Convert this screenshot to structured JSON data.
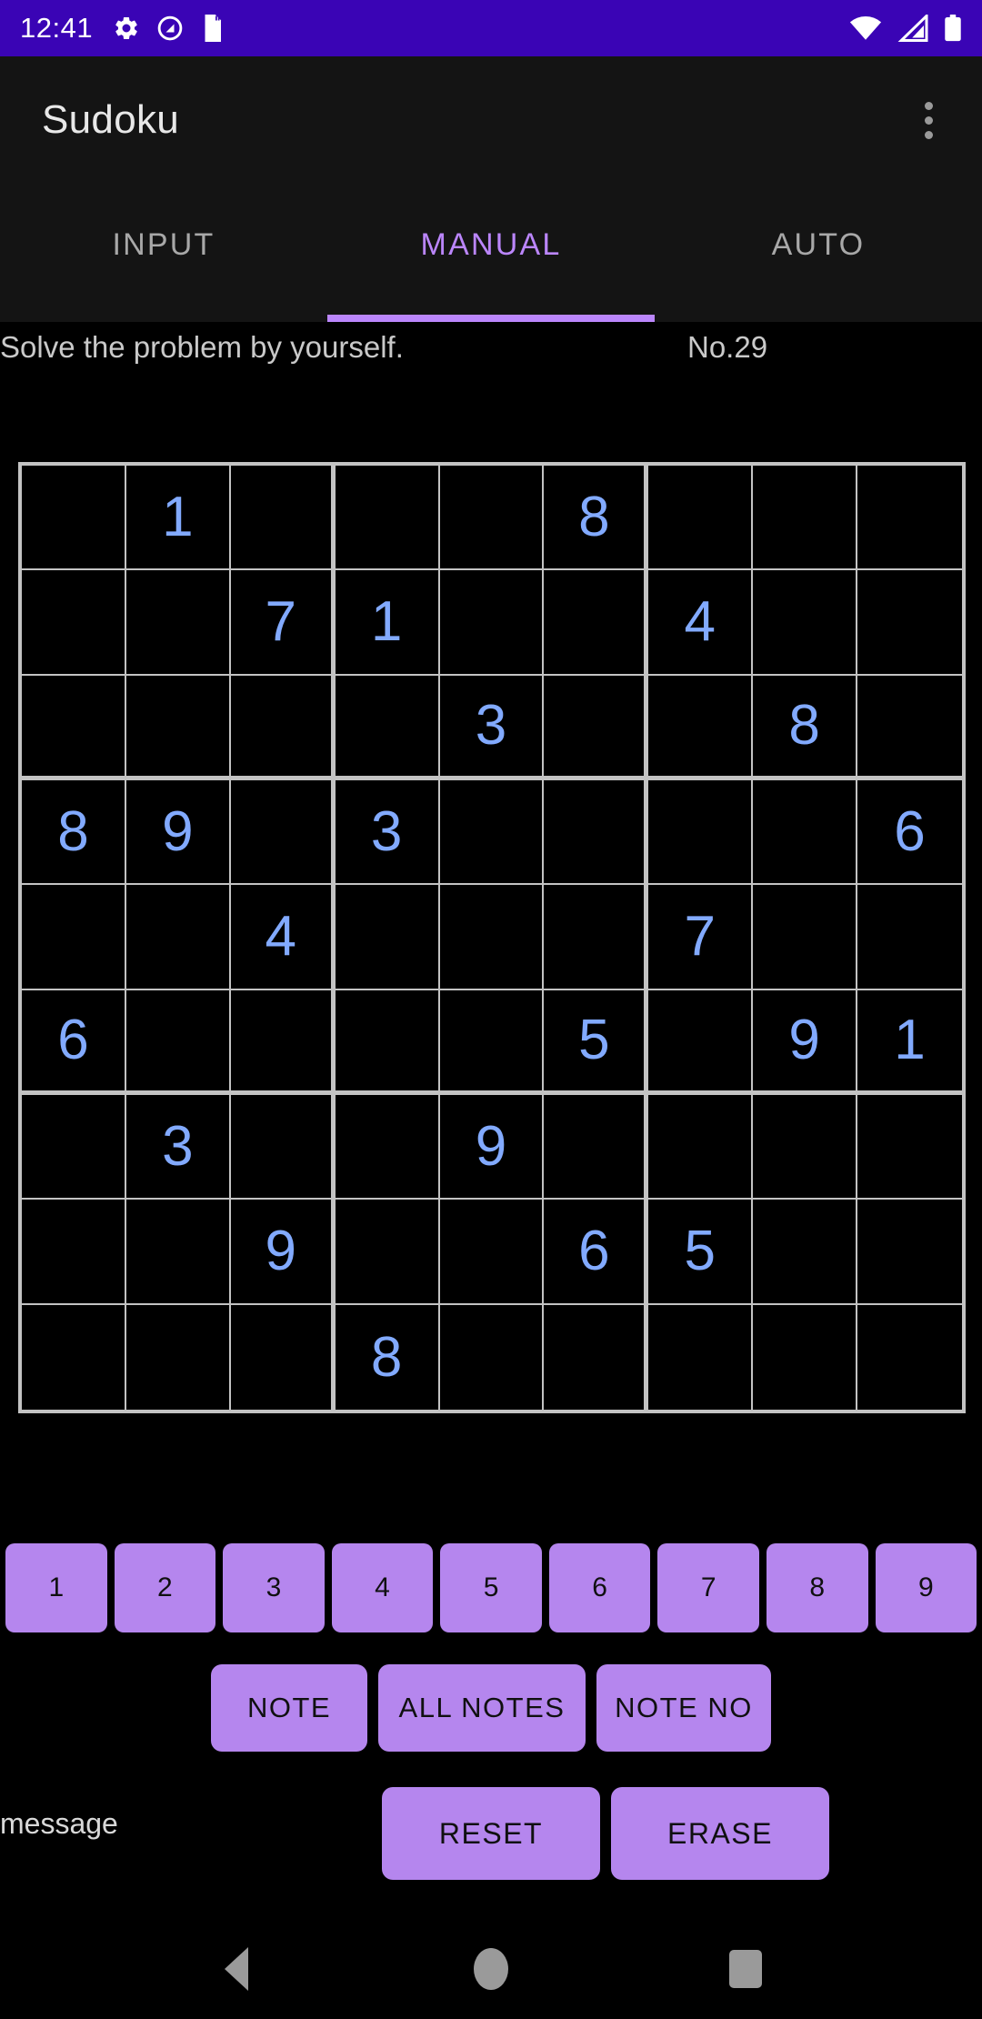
{
  "statusbar": {
    "time": "12:41",
    "left_icons": [
      "gear-icon",
      "do-not-disturb-icon",
      "sd-card-icon"
    ],
    "right_icons": [
      "wifi-icon",
      "cell-signal-icon",
      "battery-icon"
    ],
    "background_color": "#3A04B5"
  },
  "appbar": {
    "title": "Sudoku",
    "overflow_icon": "overflow-menu-icon"
  },
  "tabs": [
    {
      "label": "INPUT",
      "active": false
    },
    {
      "label": "MANUAL",
      "active": true
    },
    {
      "label": "AUTO",
      "active": false
    }
  ],
  "accent_color": "#BB86FC",
  "subtitle": {
    "description": "Solve the problem by yourself.",
    "puzzle_no": "No.29"
  },
  "board": {
    "number_color": "#82AAFF",
    "grid_line_color": "#C3C3C3",
    "cell_background": "#000000",
    "rows": [
      [
        "",
        "1",
        "",
        "",
        "",
        "8",
        "",
        "",
        ""
      ],
      [
        "",
        "",
        "7",
        "1",
        "",
        "",
        "4",
        "",
        ""
      ],
      [
        "",
        "",
        "",
        "",
        "3",
        "",
        "",
        "8",
        ""
      ],
      [
        "8",
        "9",
        "",
        "3",
        "",
        "",
        "",
        "",
        "6"
      ],
      [
        "",
        "",
        "4",
        "",
        "",
        "",
        "7",
        "",
        ""
      ],
      [
        "6",
        "",
        "",
        "",
        "",
        "5",
        "",
        "9",
        "1"
      ],
      [
        "",
        "3",
        "",
        "",
        "9",
        "",
        "",
        "",
        ""
      ],
      [
        "",
        "",
        "9",
        "",
        "",
        "6",
        "5",
        "",
        ""
      ],
      [
        "",
        "",
        "",
        "8",
        "",
        "",
        "",
        "",
        ""
      ]
    ]
  },
  "numpad": {
    "button_color": "#B586EE",
    "buttons": [
      "1",
      "2",
      "3",
      "4",
      "5",
      "6",
      "7",
      "8",
      "9"
    ]
  },
  "note_buttons": [
    {
      "label": "NOTE"
    },
    {
      "label": "ALL NOTES"
    },
    {
      "label": "NOTE NO"
    }
  ],
  "message": {
    "text": "message"
  },
  "action_buttons": [
    {
      "label": "RESET"
    },
    {
      "label": "ERASE"
    }
  ],
  "navbar": {
    "back": "back-icon",
    "home": "home-icon",
    "recents": "recents-icon"
  }
}
